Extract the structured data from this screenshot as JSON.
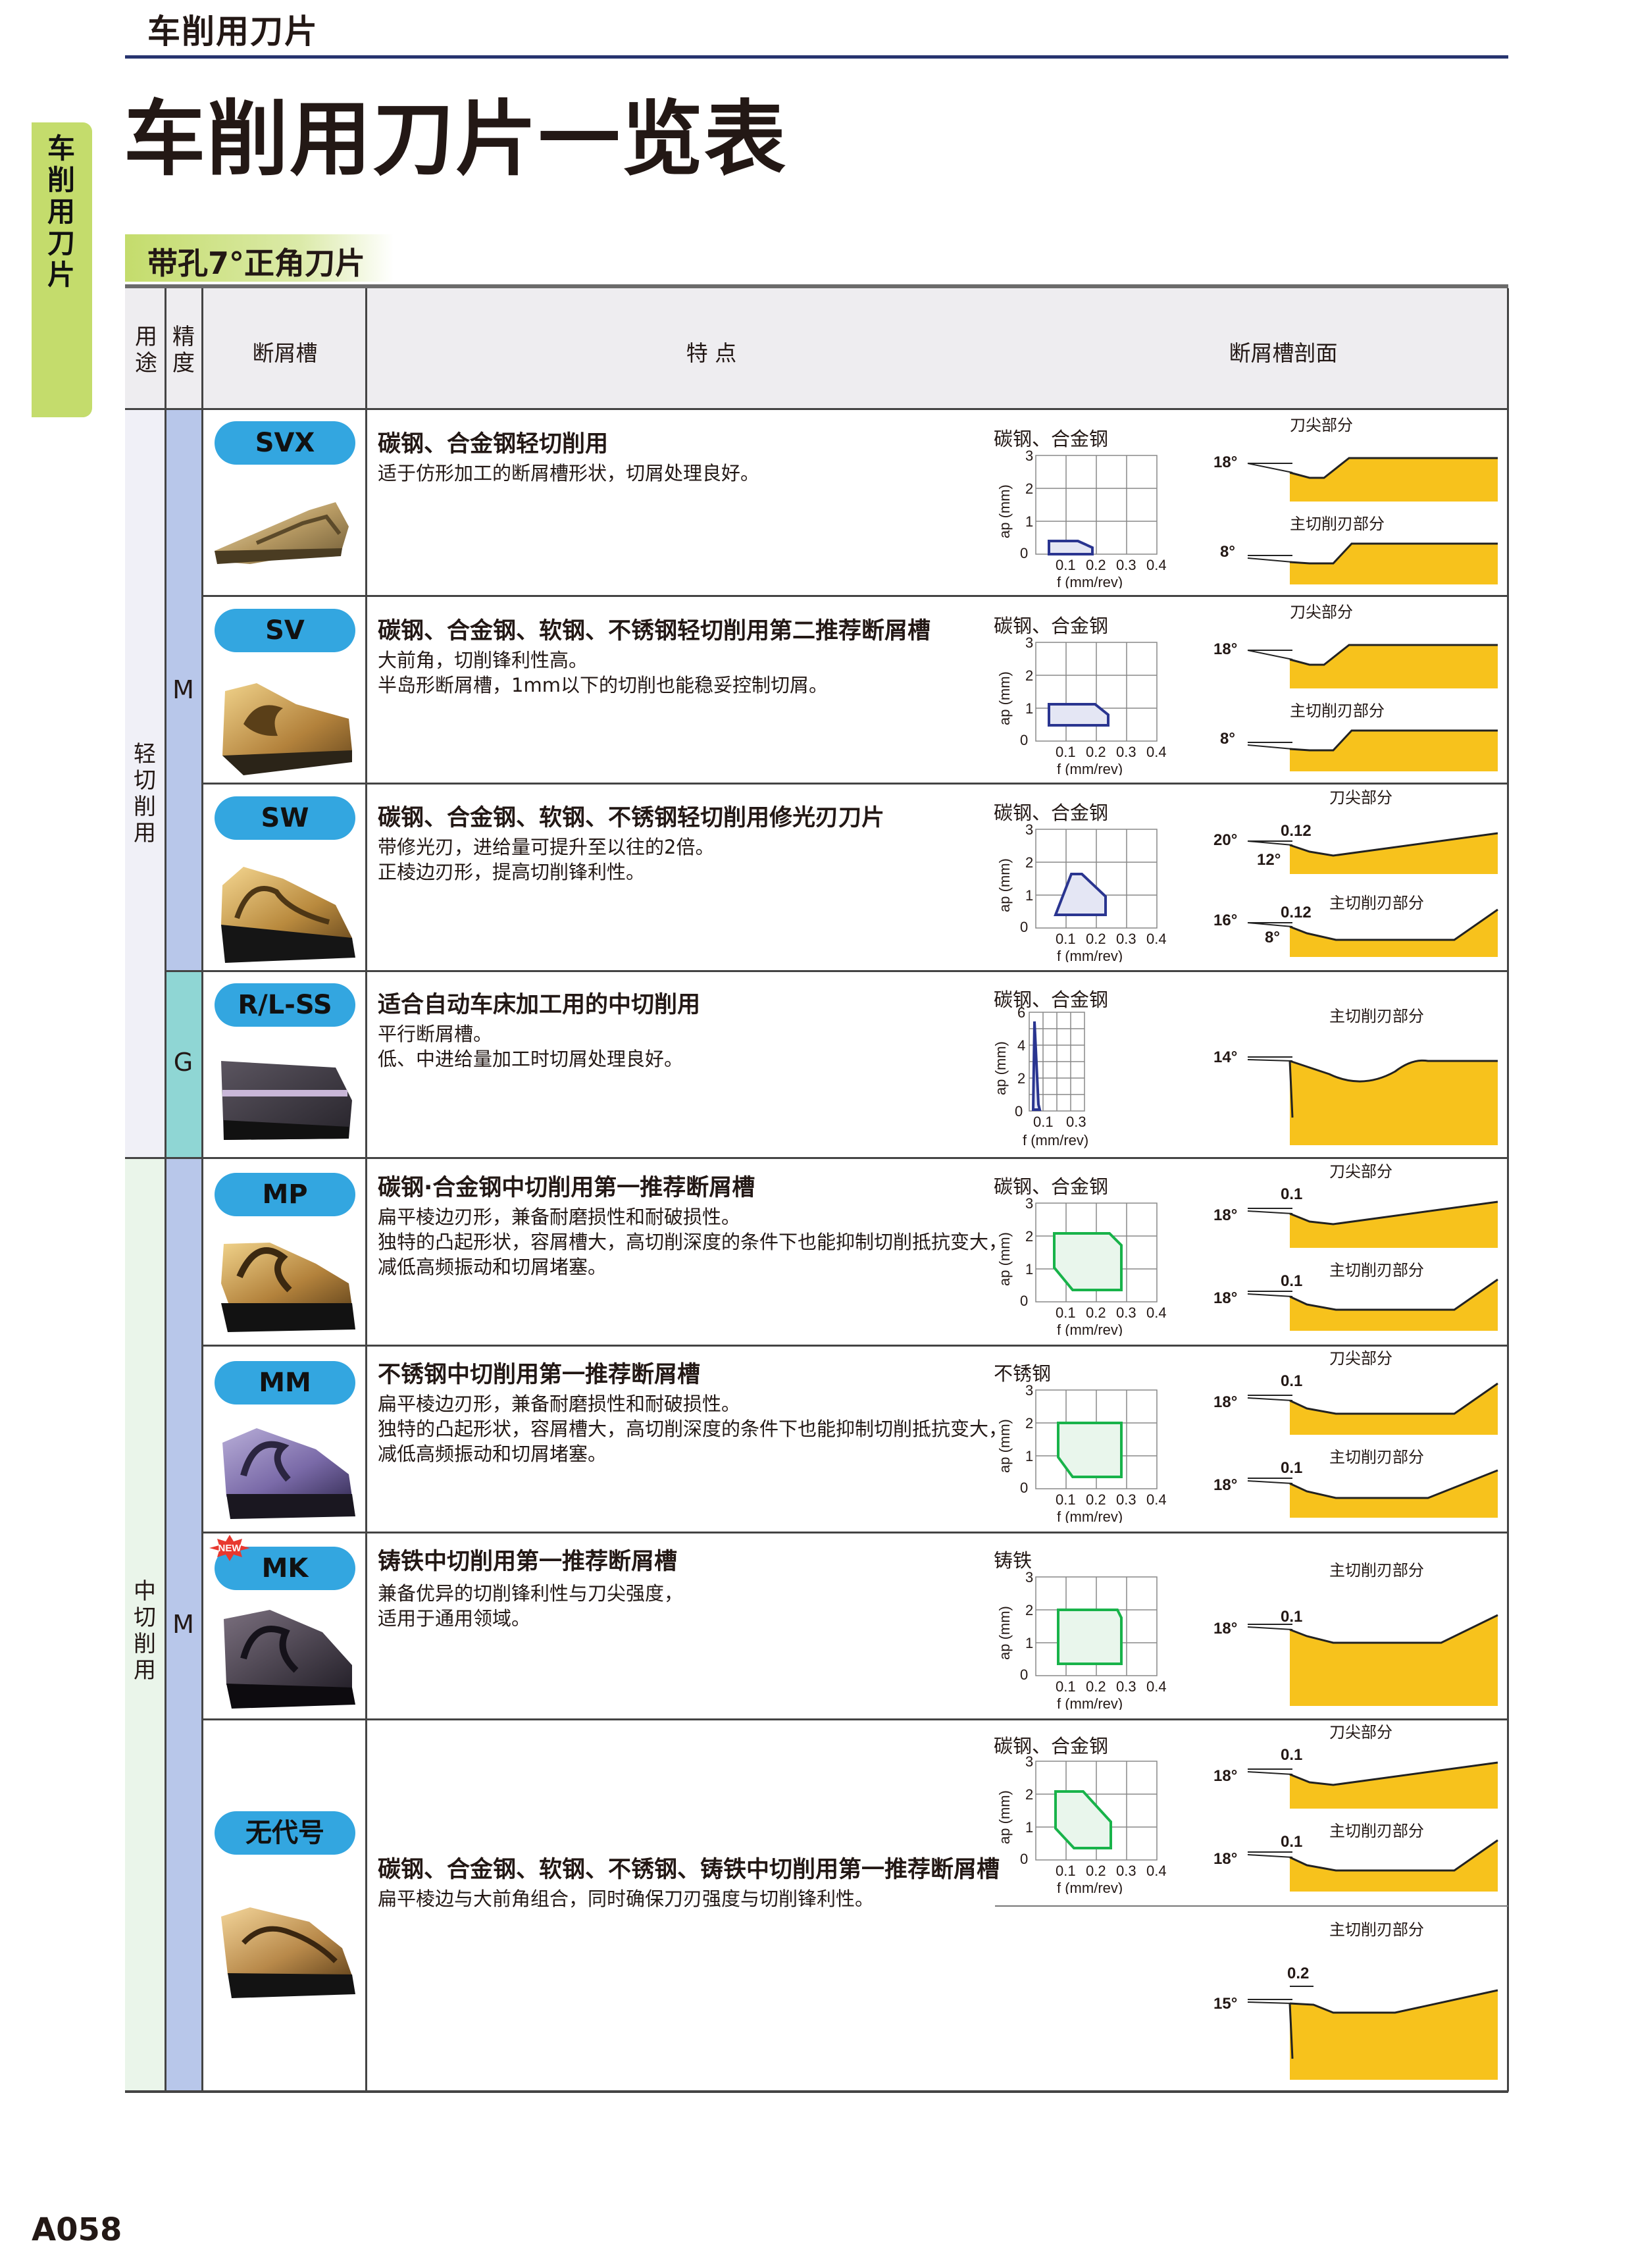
{
  "header": {
    "breadcrumb": "车削用刀片",
    "side_tab": "车削用刀片",
    "title": "车削用刀片一览表",
    "section": "带孔7°正角刀片"
  },
  "table_header": {
    "usage": "用途",
    "precision": "精度",
    "chipbreaker": "断屑槽",
    "features": "特 点",
    "profile": "断屑槽剖面"
  },
  "groups": {
    "light": "轻切削用",
    "medium": "中切削用"
  },
  "precision": {
    "m1": "M",
    "g": "G",
    "m2": "M"
  },
  "chart_common": {
    "ylabel": "ap (mm)",
    "xlabel": "f (mm/rev)",
    "xticks": [
      "0.1",
      "0.2",
      "0.3",
      "0.4"
    ],
    "yticks": [
      "3",
      "2",
      "1"
    ],
    "zero": "0"
  },
  "profile_labels": {
    "tip": "刀尖部分",
    "main": "主切削刃部分"
  },
  "new_badge": "NEW",
  "rows": [
    {
      "name": "SVX",
      "title": "碳钢、合金钢轻切削用",
      "desc": [
        "适于仿形加工的断屑槽形状，切屑处理良好。"
      ],
      "material": "碳钢、合金钢",
      "angles": {
        "tip": "18°",
        "main": "8°"
      }
    },
    {
      "name": "SV",
      "title": "碳钢、合金钢、软钢、不锈钢轻切削用第二推荐断屑槽",
      "desc": [
        "大前角，切削锋利性高。",
        "半岛形断屑槽，1mm以下的切削也能稳妥控制切屑。"
      ],
      "material": "碳钢、合金钢",
      "angles": {
        "tip": "18°",
        "main": "8°"
      }
    },
    {
      "name": "SW",
      "title": "碳钢、合金钢、软钢、不锈钢轻切削用修光刃刀片",
      "desc": [
        "带修光刃，进给量可提升至以往的2倍。",
        "正棱边刃形，提高切削锋利性。"
      ],
      "material": "碳钢、合金钢",
      "angles": {
        "tip": "20°",
        "tip_land": "0.12",
        "tip_land_angle": "12°",
        "main": "16°",
        "main_land": "0.12",
        "main_land_angle": "8°"
      }
    },
    {
      "name": "R/L-SS",
      "title": "适合自动车床加工用的中切削用",
      "desc": [
        "平行断屑槽。",
        "低、中进给量加工时切屑处理良好。"
      ],
      "material": "碳钢、合金钢",
      "chart": {
        "yticks": [
          "6",
          "4",
          "2"
        ],
        "xticks": [
          "0.1",
          "0.3"
        ]
      },
      "angles": {
        "main": "14°"
      }
    },
    {
      "name": "MP",
      "title": "碳钢·合金钢中切削用第一推荐断屑槽",
      "desc": [
        "扁平棱边刃形，兼备耐磨损性和耐破损性。",
        "独特的凸起形状，容屑槽大，高切削深度的条件下也能抑制切削抵抗变大，",
        "减低高频振动和切屑堵塞。"
      ],
      "material": "碳钢、合金钢",
      "angles": {
        "tip": "18°",
        "tip_land": "0.1",
        "main": "18°",
        "main_land": "0.1"
      }
    },
    {
      "name": "MM",
      "title": "不锈钢中切削用第一推荐断屑槽",
      "desc": [
        "扁平棱边刃形，兼备耐磨损性和耐破损性。",
        "独特的凸起形状，容屑槽大，高切削深度的条件下也能抑制切削抵抗变大，",
        "减低高频振动和切屑堵塞。"
      ],
      "material": "不锈钢",
      "angles": {
        "tip": "18°",
        "tip_land": "0.1",
        "main": "18°",
        "main_land": "0.1"
      }
    },
    {
      "name": "MK",
      "title": "铸铁中切削用第一推荐断屑槽",
      "desc": [
        "兼备优异的切削锋利性与刀尖强度，",
        "适用于通用领域。"
      ],
      "material": "铸铁",
      "angles": {
        "main": "18°",
        "main_land": "0.1"
      }
    },
    {
      "name": "无代号",
      "title": "碳钢、合金钢、软钢、不锈钢、铸铁中切削用第一推荐断屑槽",
      "desc": [
        "扁平棱边与大前角组合，同时确保刀刃强度与切削锋利性。"
      ],
      "material": "碳钢、合金钢",
      "angles": {
        "tip": "18°",
        "tip_land": "0.1",
        "main": "18°",
        "main_land": "0.1",
        "main2": "15°",
        "main2_land": "0.2"
      }
    }
  ],
  "colors": {
    "badge": "#33a6e0",
    "profile_fill": "#f7c21c",
    "light_chart": "#2a3590",
    "green_chart": "#18b34a",
    "side_tab": "#c4dc6c"
  },
  "page_number": "A058"
}
